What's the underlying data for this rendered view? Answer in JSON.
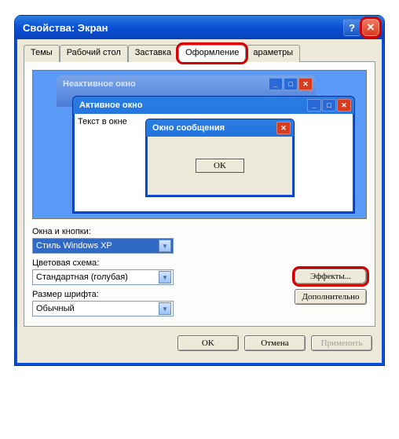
{
  "titlebar": {
    "title": "Свойства: Экран",
    "help": "?",
    "close": "✕"
  },
  "tabs": [
    "Темы",
    "Рабочий стол",
    "Заставка",
    "Оформление",
    "араметры"
  ],
  "activeTab": 3,
  "preview": {
    "inactive": "Неактивное окно",
    "active": "Активное окно",
    "text": "Текст в окне",
    "msgTitle": "Окно сообщения",
    "ok": "OK",
    "sysMin": "_",
    "sysMax": "□",
    "sysClose": "✕"
  },
  "labels": {
    "windows": "Окна и кнопки:",
    "colors": "Цветовая схема:",
    "fontsize": "Размер шрифта:"
  },
  "values": {
    "windows": "Стиль Windows XP",
    "colors": "Стандартная (голубая)",
    "fontsize": "Обычный"
  },
  "buttons": {
    "effects": "Эффекты...",
    "advanced": "Дополнительно",
    "ok": "OK",
    "cancel": "Отмена",
    "apply": "Применить"
  }
}
